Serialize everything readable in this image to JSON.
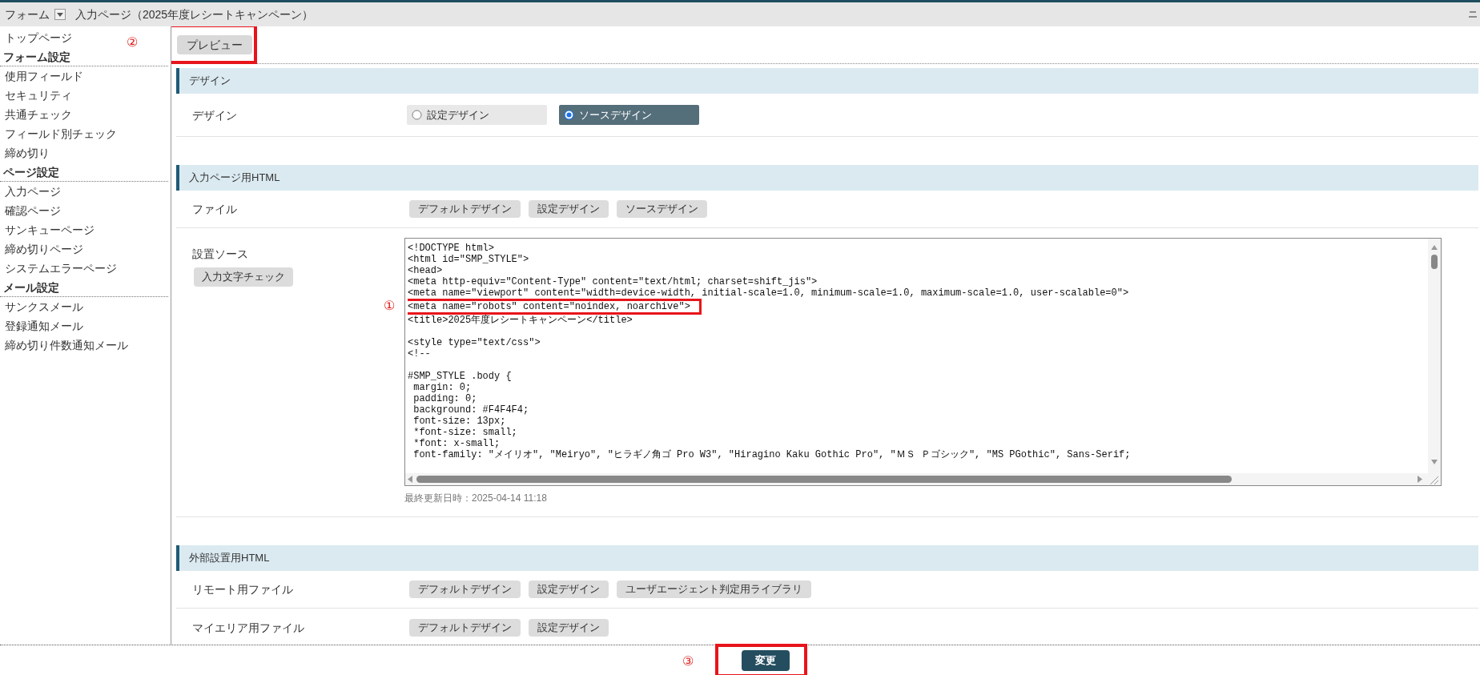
{
  "header": {
    "menu_label": "フォーム",
    "page_title": "入力ページ（2025年度レシートキャンペーン）"
  },
  "sidebar": [
    {
      "kind": "link",
      "label": "トップページ"
    },
    {
      "kind": "heading",
      "label": "フォーム設定"
    },
    {
      "kind": "link",
      "label": "使用フィールド"
    },
    {
      "kind": "link",
      "label": "セキュリティ"
    },
    {
      "kind": "link",
      "label": "共通チェック"
    },
    {
      "kind": "link",
      "label": "フィールド別チェック"
    },
    {
      "kind": "link",
      "label": "締め切り"
    },
    {
      "kind": "heading",
      "label": "ページ設定"
    },
    {
      "kind": "link",
      "label": "入力ページ"
    },
    {
      "kind": "link",
      "label": "確認ページ"
    },
    {
      "kind": "link",
      "label": "サンキューページ"
    },
    {
      "kind": "link",
      "label": "締め切りページ"
    },
    {
      "kind": "link",
      "label": "システムエラーページ"
    },
    {
      "kind": "heading",
      "label": "メール設定"
    },
    {
      "kind": "link",
      "label": "サンクスメール"
    },
    {
      "kind": "link",
      "label": "登録通知メール"
    },
    {
      "kind": "link",
      "label": "締め切り件数通知メール"
    }
  ],
  "toolbar": {
    "preview_button": "プレビュー",
    "annotation": "②"
  },
  "sections": [
    {
      "title": "デザイン",
      "rows": [
        {
          "kind": "radio",
          "label": "デザイン",
          "options": [
            {
              "label": "設定デザイン",
              "selected": false
            },
            {
              "label": "ソースデザイン",
              "selected": true
            }
          ]
        }
      ]
    },
    {
      "title": "入力ページ用HTML",
      "rows": [
        {
          "kind": "buttons",
          "label": "ファイル",
          "buttons": [
            "デフォルトデザイン",
            "設定デザイン",
            "ソースデザイン"
          ]
        },
        {
          "kind": "source",
          "label": "設置ソース",
          "button": "入力文字チェック",
          "annotation": "①",
          "code": "<!DOCTYPE html>\n<html id=\"SMP_STYLE\">\n<head>\n<meta http-equiv=\"Content-Type\" content=\"text/html; charset=shift_jis\">\n<meta name=\"viewport\" content=\"width=device-width, initial-scale=1.0, minimum-scale=1.0, maximum-scale=1.0, user-scalable=0\">\n<meta name=\"robots\" content=\"noindex, noarchive\">\n<title>2025年度レシートキャンペーン</title>\n\n<style type=\"text/css\">\n<!--\n\n#SMP_STYLE .body {\n margin: 0;\n padding: 0;\n background: #F4F4F4;\n font-size: 13px;\n *font-size: small;\n *font: x-small;\n font-family: \"メイリオ\", \"Meiryo\", \"ヒラギノ角ゴ Pro W3\", \"Hiragino Kaku Gothic Pro\", \"ＭＳ Ｐゴシック\", \"MS PGothic\", Sans-Serif;",
          "updated": "最終更新日時：2025-04-14 11:18"
        }
      ]
    },
    {
      "title": "外部設置用HTML",
      "rows": [
        {
          "kind": "buttons",
          "label": "リモート用ファイル",
          "buttons": [
            "デフォルトデザイン",
            "設定デザイン",
            "ユーザエージェント判定用ライブラリ"
          ]
        },
        {
          "kind": "buttons",
          "label": "マイエリア用ファイル",
          "buttons": [
            "デフォルトデザイン",
            "設定デザイン"
          ]
        }
      ]
    }
  ],
  "footer": {
    "submit_button": "変更",
    "annotation": "③"
  }
}
